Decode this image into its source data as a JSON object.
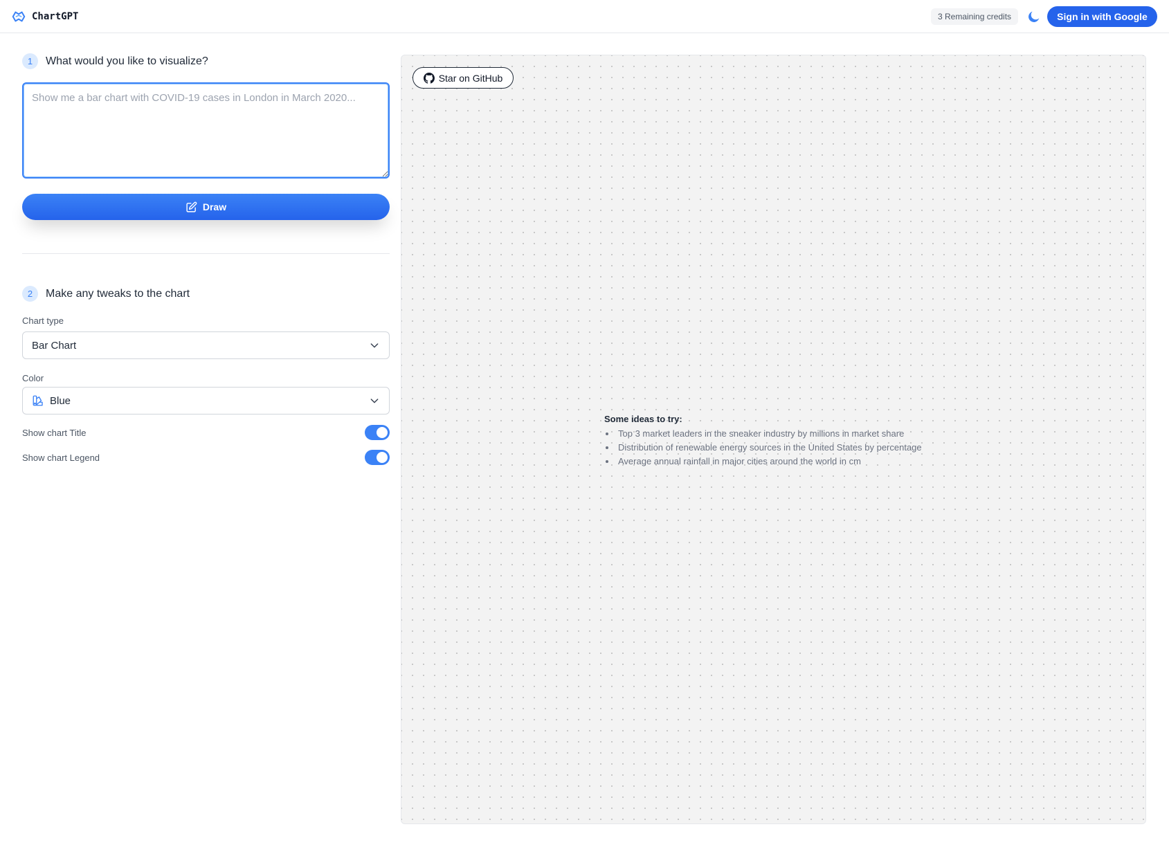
{
  "header": {
    "brand": "ChartGPT",
    "credits": "3 Remaining credits",
    "signin_label": "Sign in with Google",
    "accent": "#2563eb"
  },
  "step1": {
    "number": "1",
    "label": "What would you like to visualize?",
    "prompt_value": "",
    "prompt_placeholder": "Show me a bar chart with COVID-19 cases in London in March 2020...",
    "draw_label": "Draw"
  },
  "step2": {
    "number": "2",
    "label": "Make any tweaks to the chart",
    "chart_type_label": "Chart type",
    "chart_type_value": "Bar Chart",
    "color_label": "Color",
    "color_value": "Blue",
    "show_title_label": "Show chart Title",
    "show_title_on": true,
    "show_legend_label": "Show chart Legend",
    "show_legend_on": true
  },
  "canvas": {
    "github_label": "Star on GitHub",
    "ideas_title": "Some ideas to try:",
    "ideas": [
      "Top 3 market leaders in the sneaker industry by millions in market share",
      "Distribution of renewable energy sources in the United States by percentage",
      "Average annual rainfall in major cities around the world in cm"
    ]
  },
  "icons": {
    "logo": "chartgpt-logo-icon",
    "theme": "moon-icon",
    "draw": "pencil-square-icon",
    "chevron": "chevron-down-icon",
    "color": "palette-icon",
    "github": "github-icon"
  }
}
